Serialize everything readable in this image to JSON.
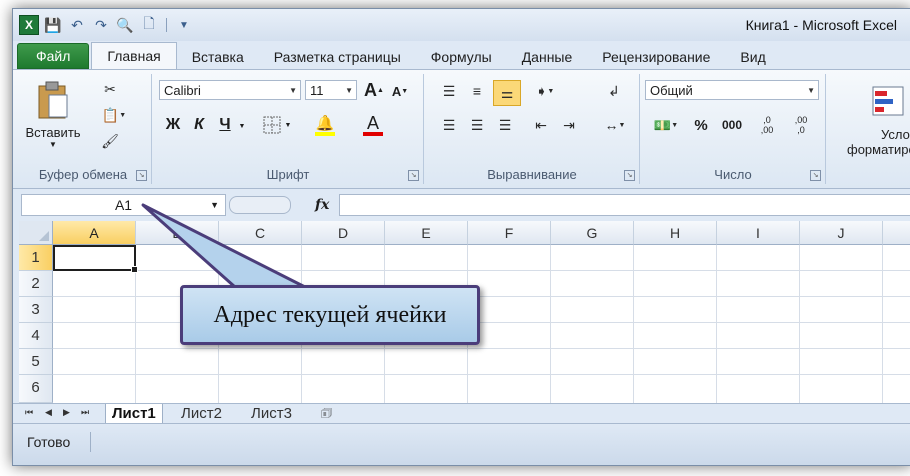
{
  "window": {
    "title": "Книга1  -  Microsoft Excel",
    "logo": "X"
  },
  "qat": {
    "icons": [
      "save-icon",
      "undo-icon",
      "redo-icon",
      "print-preview-icon",
      "new-icon",
      "customize-icon"
    ]
  },
  "tabs": [
    {
      "label": "Файл"
    },
    {
      "label": "Главная"
    },
    {
      "label": "Вставка"
    },
    {
      "label": "Разметка страницы"
    },
    {
      "label": "Формулы"
    },
    {
      "label": "Данные"
    },
    {
      "label": "Рецензирование"
    },
    {
      "label": "Вид"
    }
  ],
  "ribbon": {
    "clipboard": {
      "label": "Буфер обмена",
      "paste_label": "Вставить"
    },
    "font": {
      "label": "Шрифт",
      "font_name": "Calibri",
      "font_size": "11",
      "bold": "Ж",
      "italic": "К",
      "underline": "Ч",
      "grow": "A",
      "shrink": "A",
      "font_color_letter": "A"
    },
    "alignment": {
      "label": "Выравнивание"
    },
    "number": {
      "label": "Число",
      "format": "Общий",
      "percent": "%",
      "thousands": "000",
      "inc_decimal": ",0\n,00",
      "dec_decimal": ",00\n,0"
    },
    "styles": {
      "label_line1": "Услов",
      "label_line2": "форматиро"
    }
  },
  "formula_bar": {
    "name_box": "A1",
    "fx": "fx",
    "value": ""
  },
  "grid": {
    "columns": [
      "A",
      "B",
      "C",
      "D",
      "E",
      "F",
      "G",
      "H",
      "I",
      "J"
    ],
    "rows": [
      "1",
      "2",
      "3",
      "4",
      "5",
      "6"
    ],
    "active_cell": "A1"
  },
  "sheets": [
    {
      "name": "Лист1"
    },
    {
      "name": "Лист2"
    },
    {
      "name": "Лист3"
    }
  ],
  "status": {
    "text": "Готово"
  },
  "callout": {
    "text": "Адрес текущей ячейки"
  },
  "colors": {
    "file_tab": "#1e7a2e",
    "selection_header": "#f9cf62",
    "callout_fill": "#a9cbe8",
    "callout_border": "#4b3d7a"
  }
}
